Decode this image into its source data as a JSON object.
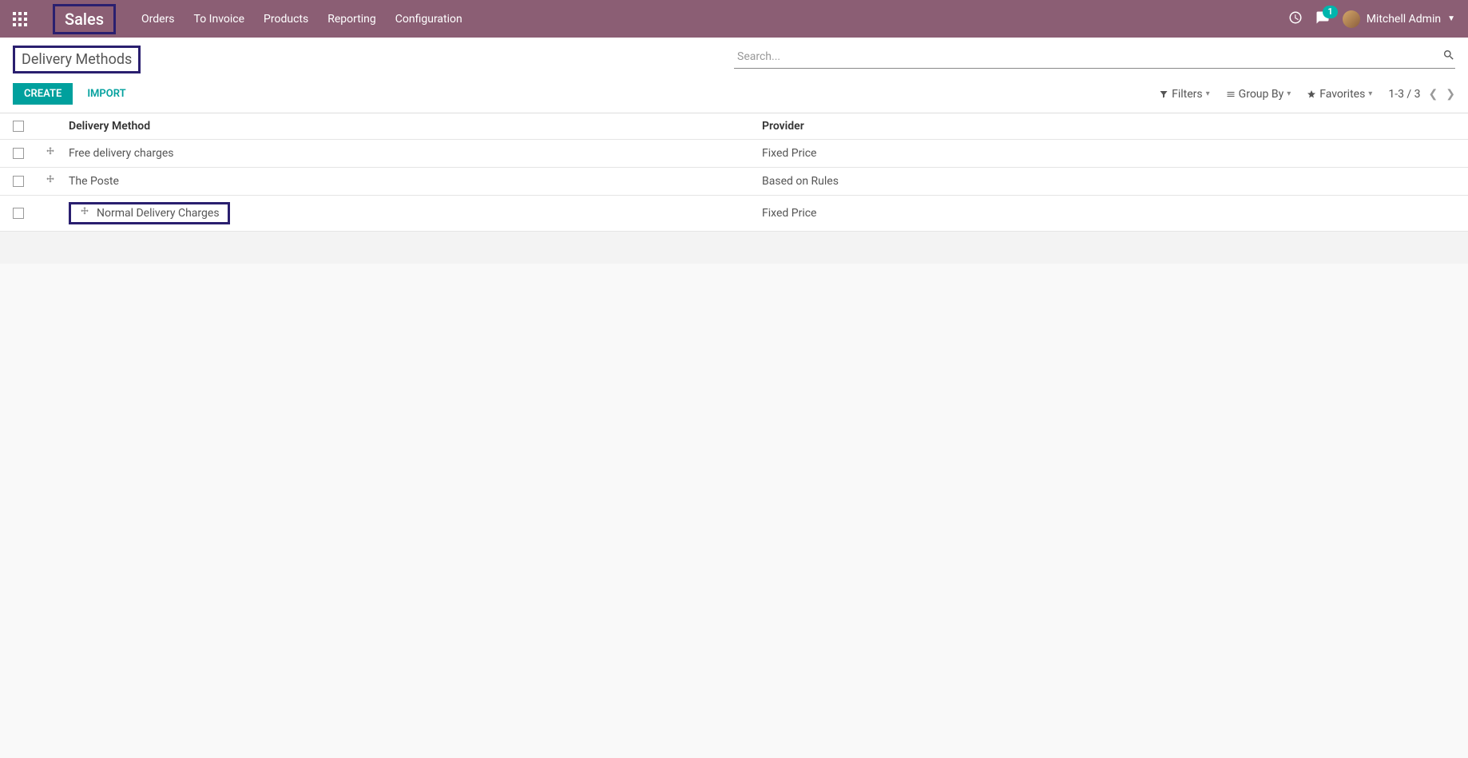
{
  "navbar": {
    "app_title": "Sales",
    "links": [
      "Orders",
      "To Invoice",
      "Products",
      "Reporting",
      "Configuration"
    ],
    "chat_badge": "1",
    "user_name": "Mitchell Admin"
  },
  "page": {
    "title": "Delivery Methods",
    "search_placeholder": "Search...",
    "create_label": "CREATE",
    "import_label": "IMPORT",
    "filters_label": "Filters",
    "groupby_label": "Group By",
    "favorites_label": "Favorites",
    "pager_text": "1-3 / 3"
  },
  "table": {
    "columns": {
      "c1": "Delivery Method",
      "c2": "Provider"
    },
    "rows": [
      {
        "name": "Free delivery charges",
        "provider": "Fixed Price",
        "hl": false
      },
      {
        "name": "The Poste",
        "provider": "Based on Rules",
        "hl": false
      },
      {
        "name": "Normal Delivery Charges",
        "provider": "Fixed Price",
        "hl": true
      }
    ]
  }
}
